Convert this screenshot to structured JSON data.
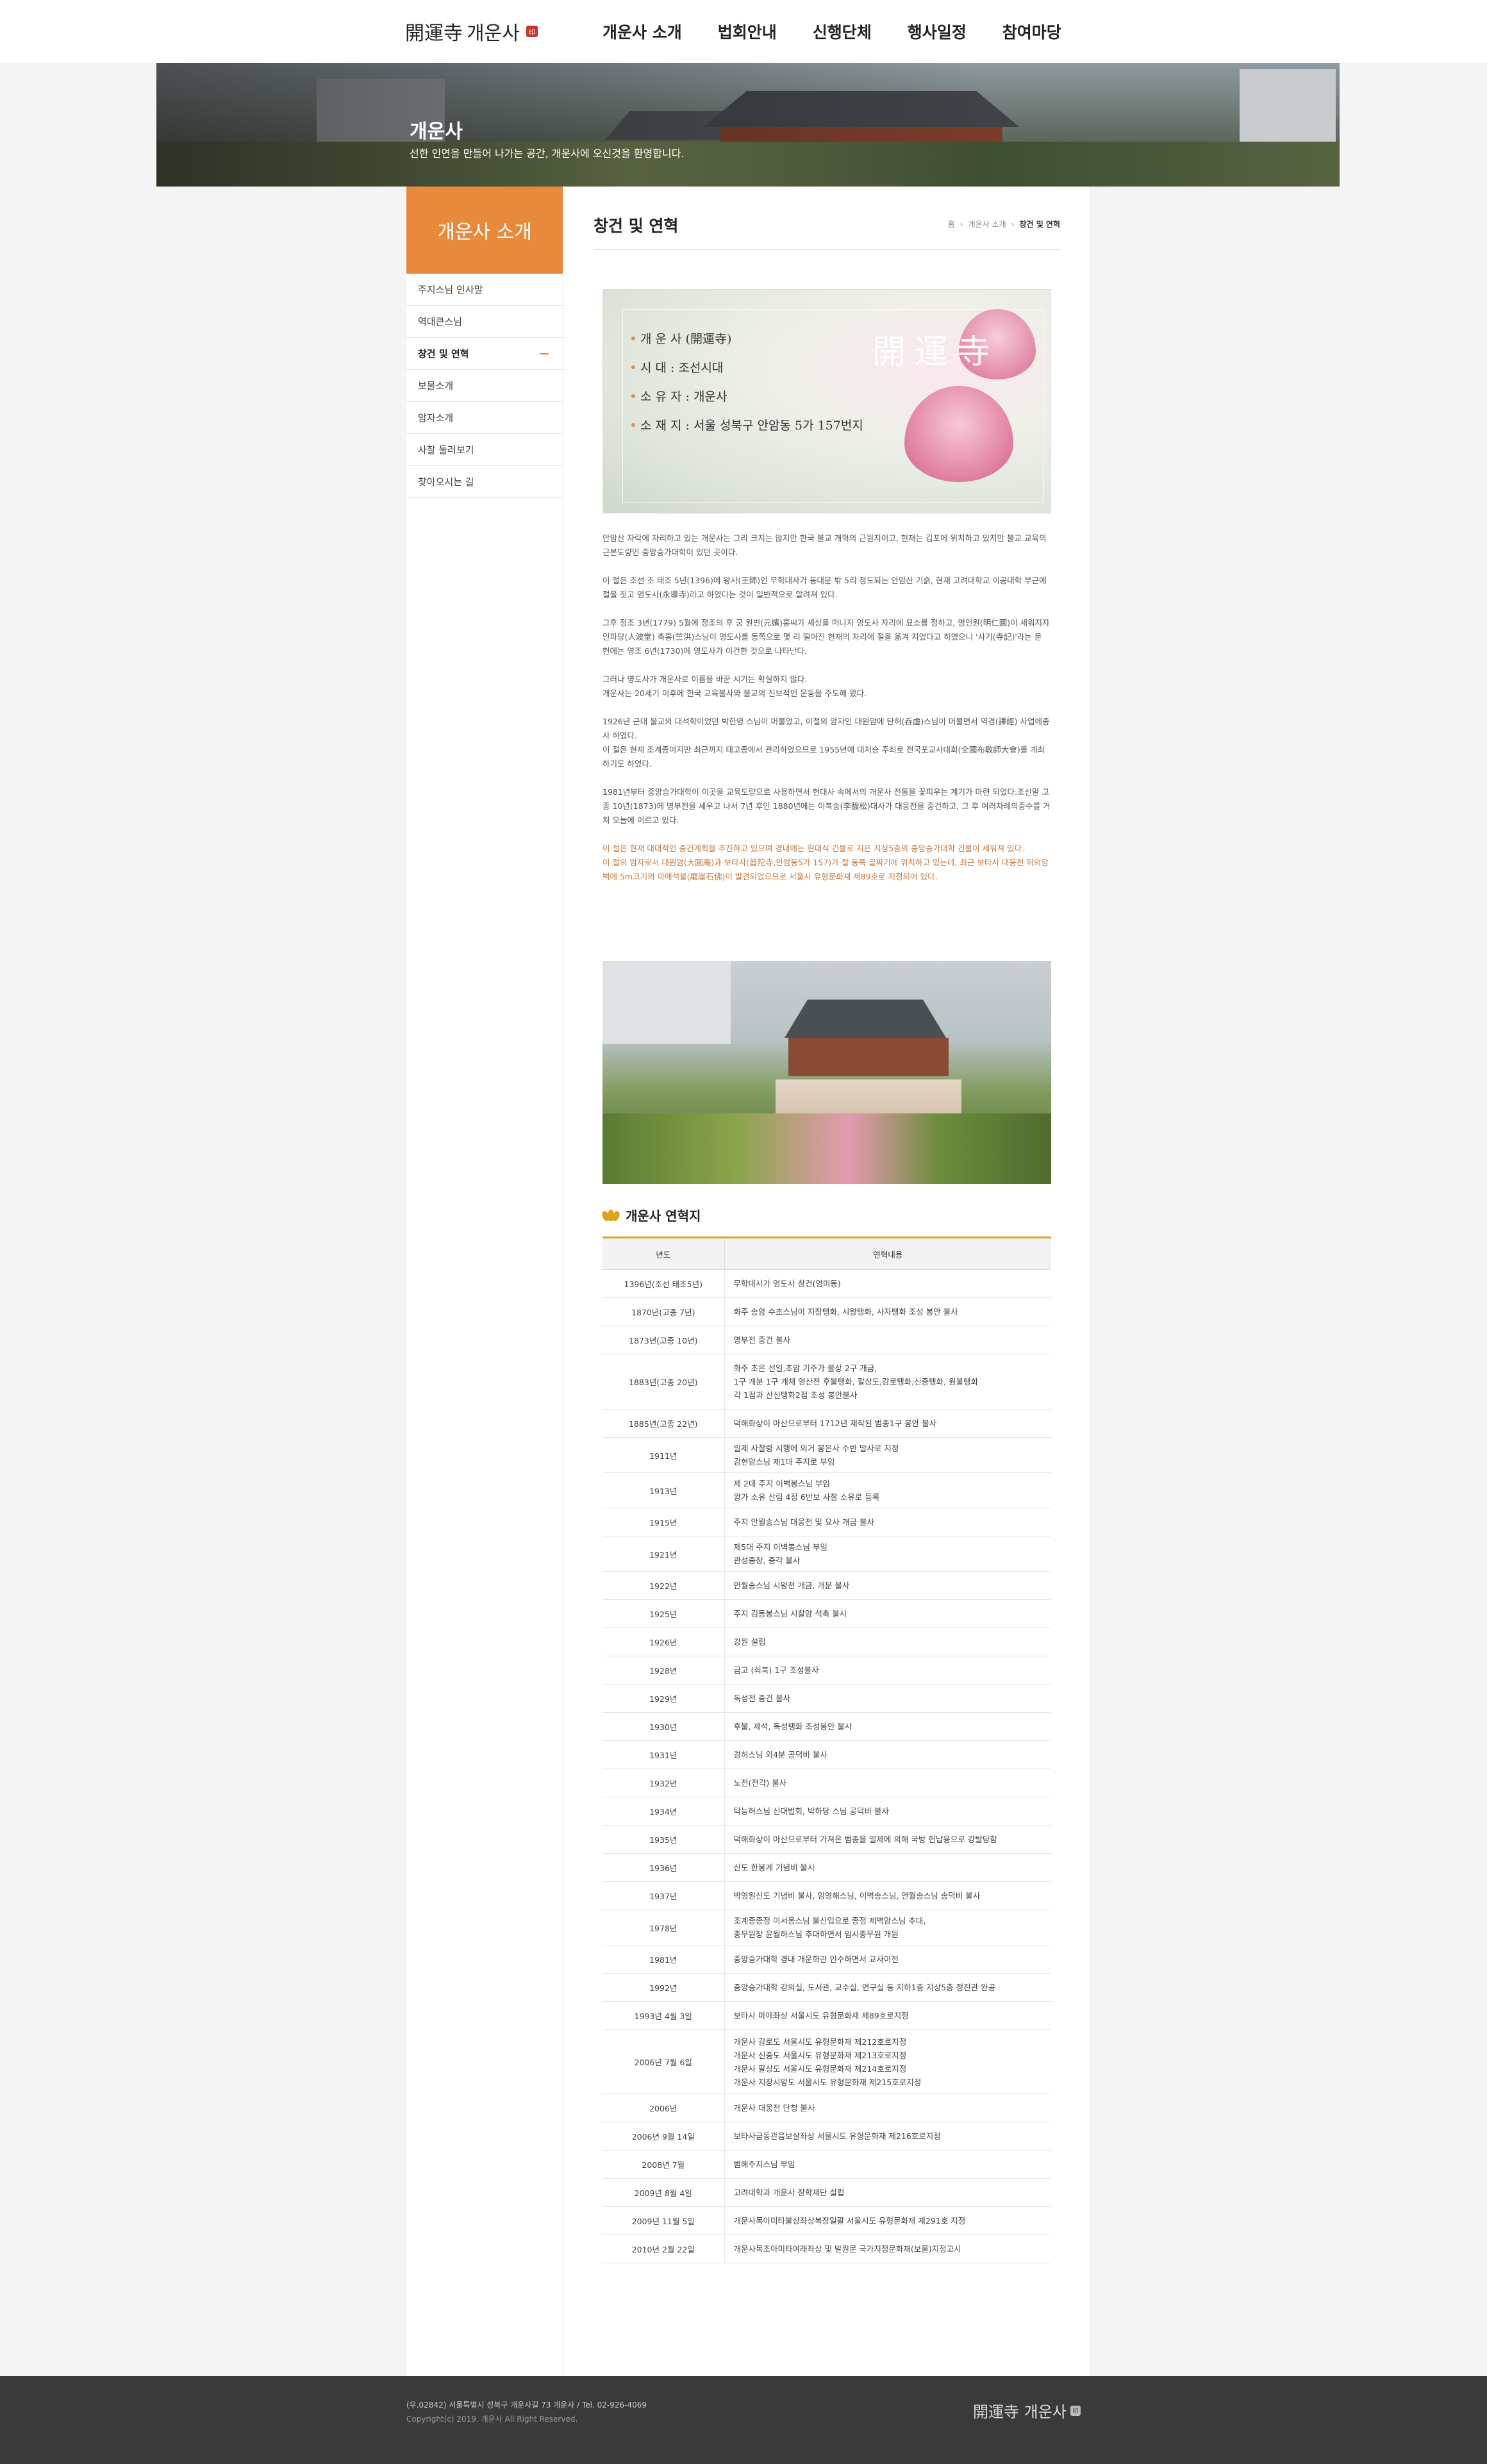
{
  "header": {
    "logo_hanja": "開運寺",
    "logo_korean": "개운사",
    "logo_seal": "印",
    "nav": [
      "개운사 소개",
      "법회안내",
      "신행단체",
      "행사일정",
      "참여마당"
    ]
  },
  "hero": {
    "title": "개운사",
    "subtitle": "선한 인연을 만들어 나가는 공간, 개운사에 오신것을 환영합니다."
  },
  "sidebar": {
    "title": "개운사 소개",
    "items": [
      {
        "label": "주지스님 인사말",
        "active": false
      },
      {
        "label": "역대큰스님",
        "active": false
      },
      {
        "label": "창건 및 연혁",
        "active": true
      },
      {
        "label": "보물소개",
        "active": false
      },
      {
        "label": "암자소개",
        "active": false
      },
      {
        "label": "사찰 둘러보기",
        "active": false
      },
      {
        "label": "찾아오시는 길",
        "active": false
      }
    ]
  },
  "page": {
    "title": "창건 및 연혁",
    "breadcrumb": [
      "홈",
      "개운사 소개",
      "창건 및 연혁"
    ]
  },
  "banner": {
    "calligraphy": "開運寺",
    "lines": [
      "개 운 사 (開運寺)",
      "시 대 : 조선시대",
      "소 유 자 : 개운사",
      "소 재 지 : 서울 성북구 안암동 5가 157번지"
    ]
  },
  "paragraphs": [
    {
      "text": "안암산 자락에 자리하고 있는 개운사는 그리 크지는 않지만 한국 불교 개혁의 근원지이고, 현재는 깁포에 위치하고 있지만 불교 교육의 근본도량인 중앙승가대학이 있던 곳이다.",
      "orange": false
    },
    {
      "text": "이 절은 조선 초 태조 5년(1396)에 왕사(王師)인 무학대사가 동대문 밖 5리 정도되는 안암산 기슭, 현재 고려대학교 이공대학 부근에 절을 짓고 영도사(永導寺)라고 하였다는 것이 일반적으로 알려져 있다.",
      "orange": false
    },
    {
      "text": "그후 정조 3년(1779) 5월에 정조의 후 궁 원빈(元嬪)홍씨가 세상을 떠나자 영도사 자리에 묘소를 정하고, 명인원(明仁園)이 세워지자 인파당(人波堂) 축홍(竺洪)스님이 영도사를 동쪽으로 몇 리 떨어진 현재의 자리에 절을 옮겨 지었다고 하였으니 '사기(寺記)'라는 문 헌에는 영조 6년(1730)에 영도사가 이건한 것으로 나타난다.",
      "orange": false
    },
    {
      "text": "그러나 영도사가 개운사로 이름을 바꾼 시기는 확실하지 않다.\n개운사는 20세기 이후에 한국 교육불사와 불교의 진보적인 운동을 주도해 왔다.",
      "orange": false
    },
    {
      "text": "1926년 근대 불교의 대석학이었던 박한영 스님이 머물었고, 이절의 암자인 대원암에 탄허(呑虛)스님이 머물면서 역경(譯經) 사업에종사 하였다.\n이 절은 현재 조계종이지만 최근까지 태고종에서 관리하였으므로 1955년에 대처승 주최로 전국포교사대회(全國布敎師大會)를 개최 하기도 하였다.",
      "orange": false
    },
    {
      "text": "1981년부터 중앙승가대학이 이곳을 교육도량으로 사용하면서 현대사 속에서의 개운사 전통을 꽃피우는 계기가 마련 되었다.조선말 고종 10년(1873)에 명부전을 세우고 나서 7년 후인 1880년에는 이복송(李馥松)대사가 대웅전을 중건하고, 그 후 여러차례의중수를 거쳐 오늘에 이르고 있다.",
      "orange": false
    },
    {
      "text": "이 절은 현재 대대적인 중건계획을 추진하고 있으며 경내에는 현대식 건물로 지은 지상5층의 중앙승가대학 건물이 세워져 있다.\n이 절의 암자로서 대원암(大圓庵)과 보타사(普陀寺,안암동5가 157)가 절 동쪽 골짜기에 위치하고 있는데, 최근 보타사 대웅전 뒤의암벽에 5m크기의 마애석불(磨崖石佛)이 발견되었으므로 서울시 유형문화재 제89호로 지정되어 있다.",
      "orange": true
    }
  ],
  "history": {
    "title": "개운사 연혁지",
    "columns": [
      "년도",
      "연혁내용"
    ],
    "rows": [
      {
        "year": "1396년(조선 태조5년)",
        "desc": "무학대사가 영도사 창건(영미동)"
      },
      {
        "year": "1870년(고종 7년)",
        "desc": "화주 송암 수초스님이 지장탱화, 시왕탱화, 사자탱화 조성 봉안 불사"
      },
      {
        "year": "1873년(고종 10년)",
        "desc": "명부전 중건 불사"
      },
      {
        "year": "1883년(고종 20년)",
        "desc": "화주 초은 선일,초암 기주가 불상 2구 개금,\n1구 개분 1구 개채 영산전 후불탱화, 팔상도,감로탱화,신중탱화, 원불탱화\n각 1점과 산신탱화2점 조성 봉안불사"
      },
      {
        "year": "1885년(고종 22년)",
        "desc": "덕해화상이 아산으로부터 1712년 제작된 범종1구 봉안 불사"
      },
      {
        "year": "1911년",
        "desc": "일제 사찰령 시행에 의거 봉은사 수반 말사로 지정\n김현암스님 제1대 주지로 부임"
      },
      {
        "year": "1913년",
        "desc": "제 2대 주지 이벽봉스님 부임\n왕가 소유 산림 4정 6반보 사찰 소유로 등록"
      },
      {
        "year": "1915년",
        "desc": "주지 안월송스님 대웅전 및 요사 개금 불사"
      },
      {
        "year": "1921년",
        "desc": "제5대 주지 이벽봉스님 부임\n관성중창, 증각 불사"
      },
      {
        "year": "1922년",
        "desc": "안월송스님 시왕전 개금, 개분 불사"
      },
      {
        "year": "1925년",
        "desc": "주지 김동봉스님 시찰암 석축 불사"
      },
      {
        "year": "1926년",
        "desc": "강원 설립"
      },
      {
        "year": "1928년",
        "desc": "금고 (쇠북) 1구 조성불사"
      },
      {
        "year": "1929년",
        "desc": "독성전 중건 불사"
      },
      {
        "year": "1930년",
        "desc": "후불, 제석, 독성탱화 조성봉안 불사"
      },
      {
        "year": "1931년",
        "desc": "경허스님 외4분 공덕비 불사"
      },
      {
        "year": "1932년",
        "desc": "노전(전각) 불사"
      },
      {
        "year": "1934년",
        "desc": "탁능허스님 신대법회, 박하당 스님 공덕비 불사"
      },
      {
        "year": "1935년",
        "desc": "덕해화상이 아산으로부터 가져온 범종을 일제에 의해 국방 헌납용으로 강탈당함"
      },
      {
        "year": "1936년",
        "desc": "신도 한봉계 기념비 불사"
      },
      {
        "year": "1937년",
        "desc": "박영원신도 기념비 불사, 임영해스님, 이벽송스님, 안월송스님 송덕비 불사"
      },
      {
        "year": "1978년",
        "desc": "조계종종정 이서옹스님 불신입으로 종정 제벽암스님 추대,\n총무원장 윤월하스님 추대하면서 임시총무원 개원"
      },
      {
        "year": "1981년",
        "desc": "중앙승가대학 경내 개운화관 인수하면서 교사이전"
      },
      {
        "year": "1992년",
        "desc": "중앙승가대학 강의실, 도서관, 교수실, 연구실 등 지하1층 지상5층 정진관 완공"
      },
      {
        "year": "1993년 4월 3일",
        "desc": "보타사 마애좌상 서울시도 유형문화재 제89호로지정"
      },
      {
        "year": "2006년 7월 6일",
        "desc": "개운사 감로도 서울시도 유형문화재 제212호로지정\n개운사 신중도 서울시도 유형문화재 제213호로지정\n개운사 팔상도 서울시도 유형문화재 제214호로지정\n개운사 지장시왕도 서울시도 유형문화재 제215호로지정"
      },
      {
        "year": "2006년",
        "desc": "개운사 대웅전 단청 불사"
      },
      {
        "year": "2006년 9월 14일",
        "desc": "보타사금동관음보살좌상 서울시도 유형문화재 제216호로지정"
      },
      {
        "year": "2008년 7월",
        "desc": "범해주지스님 부임"
      },
      {
        "year": "2009년 8월 4일",
        "desc": "고려대학과 개운사 장학재단 설립"
      },
      {
        "year": "2009년 11월 5일",
        "desc": "개운사목아미타불상좌상복장일괄 서울시도 유형문화재 제291호 지정"
      },
      {
        "year": "2010년 2월 22일",
        "desc": "개운사목조아미타여래좌상 및 발원문 국가지정문화재(보물)지정고시"
      }
    ]
  },
  "footer": {
    "address": "(우.02842) 서울특별시 성북구 개운사길 73 개운사 / Tel. 02-926-4069",
    "copyright": "Copyright(c) 2019. 개운사 All Right Reserved.",
    "logo": "開運寺 개운사",
    "seal": "印"
  },
  "colors": {
    "accent": "#e88a3c",
    "gold": "#e0a21c",
    "orange_text": "#c8783a",
    "footer_bg": "#3a3a3a"
  }
}
